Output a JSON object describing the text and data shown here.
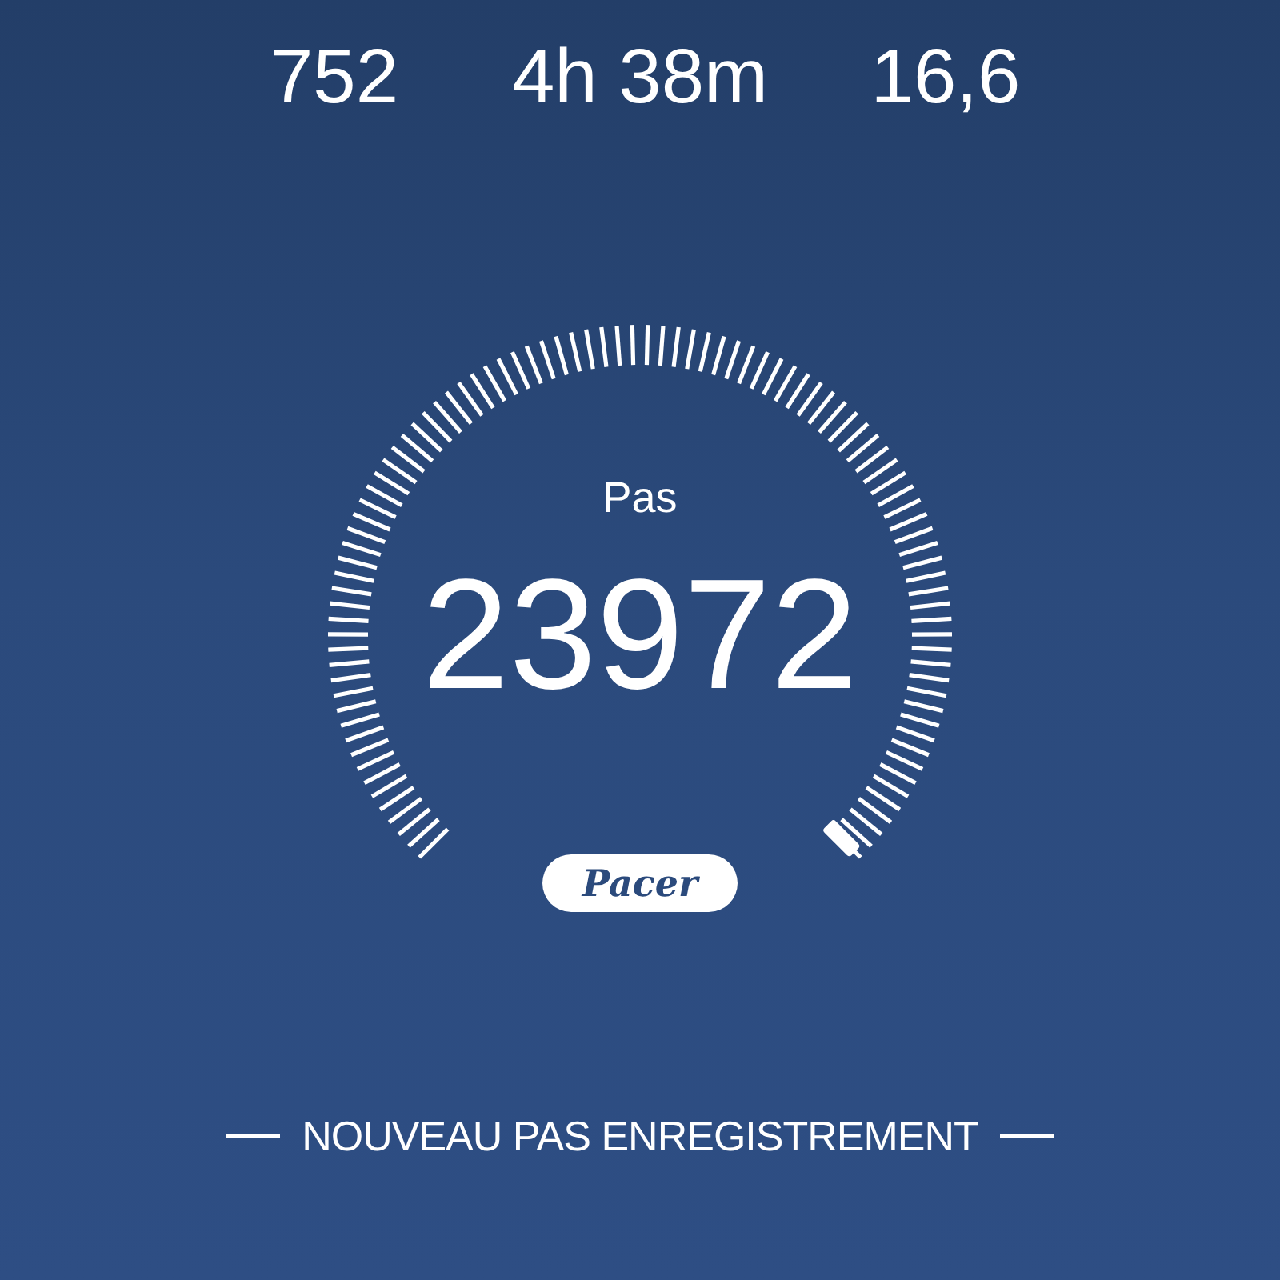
{
  "stats": [
    {
      "value": "752"
    },
    {
      "value": "4h 38m"
    },
    {
      "value": "16,6"
    }
  ],
  "gauge": {
    "label": "Pas",
    "value": "23972"
  },
  "logo": {
    "text": "Pacer"
  },
  "caption": "NOUVEAU PAS ENREGISTREMENT"
}
